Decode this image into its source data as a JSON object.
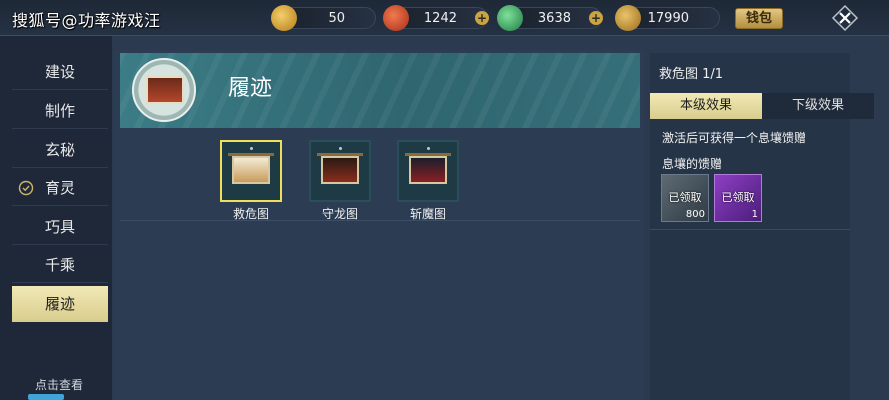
{
  "watermark": "搜狐号@功率游戏汪",
  "resources": [
    {
      "icon": "gold-coin-icon",
      "value": "50",
      "has_plus": false
    },
    {
      "icon": "red-orb-icon",
      "value": "1242",
      "has_plus": true
    },
    {
      "icon": "jade-icon",
      "value": "3638",
      "has_plus": true
    },
    {
      "icon": "leaf-coin-icon",
      "value": "17990",
      "has_plus": false
    }
  ],
  "wallet_label": "钱包",
  "nav": {
    "items": [
      {
        "label": "建设"
      },
      {
        "label": "制作"
      },
      {
        "label": "玄秘"
      },
      {
        "label": "育灵"
      },
      {
        "label": "巧具"
      },
      {
        "label": "千乘"
      },
      {
        "label": "履迹"
      }
    ],
    "hint": "点击查看"
  },
  "banner": {
    "title": "履迹"
  },
  "cards": [
    {
      "label": "救危图"
    },
    {
      "label": "守龙图"
    },
    {
      "label": "斩魔图"
    }
  ],
  "detail": {
    "title": "救危图 1/1",
    "tabs": [
      "本级效果",
      "下级效果"
    ],
    "description": "激活后可获得一个息壤馈赠",
    "reward_title": "息壤的馈赠",
    "rewards": [
      {
        "status": "已领取",
        "count": "800"
      },
      {
        "status": "已领取",
        "count": "1"
      }
    ]
  },
  "colors": {
    "accent_gold": "#d9cd8d",
    "selected_border": "#f0df5a",
    "banner_teal": "#3b7c86"
  }
}
